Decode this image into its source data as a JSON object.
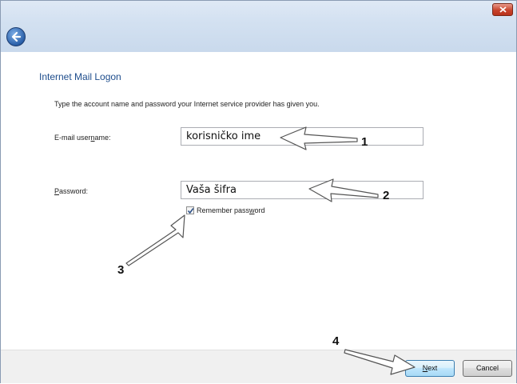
{
  "dialog": {
    "heading": "Internet Mail Logon",
    "instruction": "Type the account name and password your Internet service provider has given you."
  },
  "username": {
    "label_pre": "E-mail user",
    "label_ul": "n",
    "label_post": "ame:",
    "value": "korisničko ime"
  },
  "password": {
    "label_ul": "P",
    "label_post": "assword:",
    "value": "Vaša šifra"
  },
  "remember": {
    "label_pre": "Remember pass",
    "label_ul": "w",
    "label_post": "ord",
    "checked": true
  },
  "buttons": {
    "next_ul": "N",
    "next_post": "ext",
    "cancel": "Cancel"
  },
  "annotations": {
    "n1": "1",
    "n2": "2",
    "n3": "3",
    "n4": "4"
  },
  "icons": {
    "back": "back-arrow-icon",
    "close": "close-icon",
    "check": "checkmark-icon"
  }
}
